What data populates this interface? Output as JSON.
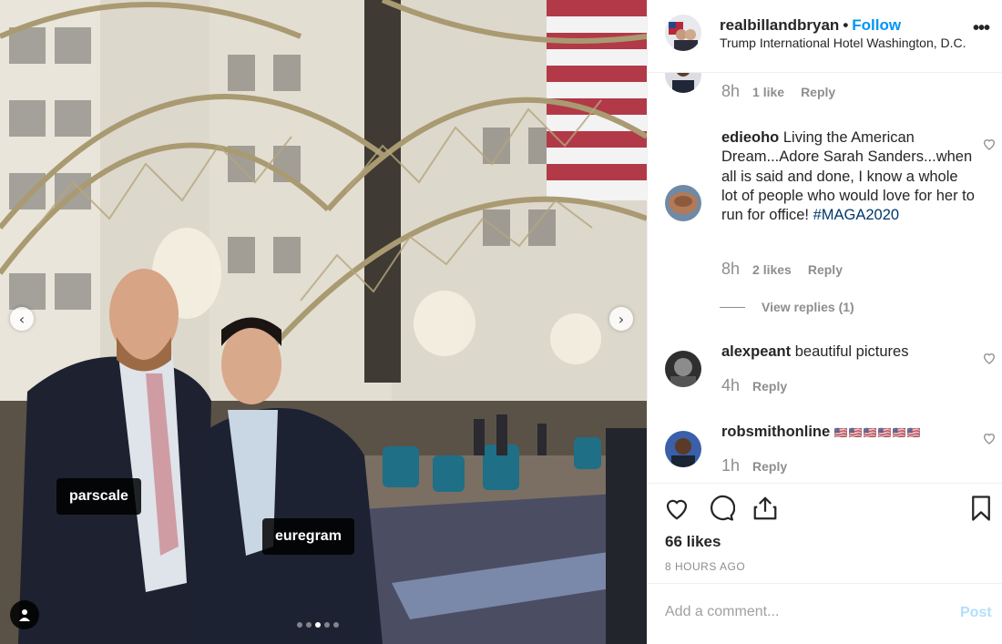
{
  "post": {
    "image_tags": [
      "parscale",
      "euregram"
    ],
    "carousel_dot_count": 5,
    "carousel_active_index": 2
  },
  "header": {
    "username": "realbillandbryan",
    "separator": "•",
    "follow_label": "Follow",
    "location": "Trump International Hotel Washington, D.C.",
    "more_label": "•••"
  },
  "comments": [
    {
      "username": "",
      "text": "",
      "time": "8h",
      "likes": "1 like",
      "reply_label": "Reply"
    },
    {
      "username": "edieoho",
      "text": "Living the American Dream...Adore Sarah Sanders...when all is said and done, I know a whole lot of people who would love for her to run for office!",
      "hashtag": "#MAGA2020",
      "time": "8h",
      "likes": "2 likes",
      "reply_label": "Reply",
      "view_replies": "View replies (1)"
    },
    {
      "username": "alexpeant",
      "text": "beautiful pictures",
      "time": "4h",
      "reply_label": "Reply"
    },
    {
      "username": "robsmithonline",
      "text": "🇺🇸🇺🇸🇺🇸🇺🇸🇺🇸🇺🇸",
      "time": "1h",
      "reply_label": "Reply"
    }
  ],
  "actions": {
    "likes": "66 likes",
    "time_ago": "8 HOURS AGO",
    "icons": [
      "heart-icon",
      "comment-icon",
      "share-icon",
      "bookmark-icon"
    ]
  },
  "comment_box": {
    "placeholder": "Add a comment...",
    "post_label": "Post"
  },
  "colors": {
    "link_blue": "#0095f6",
    "post_disabled": "#b2dffc",
    "muted": "#8e8e8e",
    "border": "#efefef"
  }
}
